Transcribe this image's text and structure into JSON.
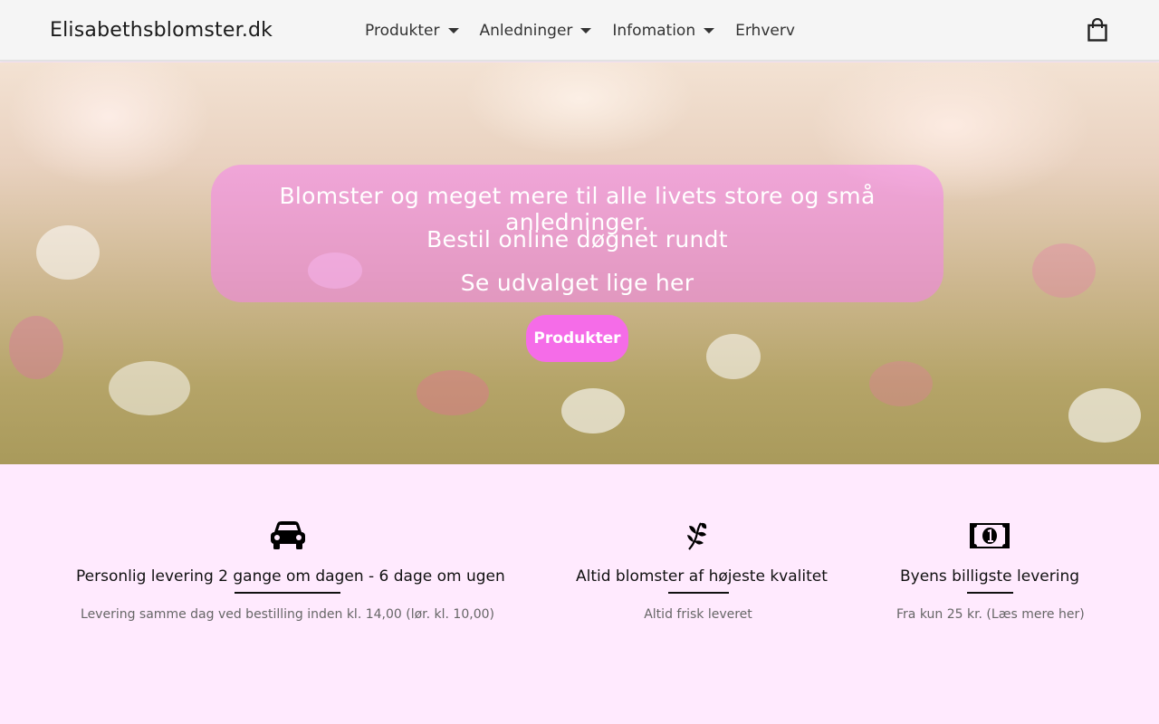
{
  "header": {
    "logo": "Elisabethsblomster.dk",
    "nav": [
      {
        "label": "Produkter",
        "dropdown": true
      },
      {
        "label": "Anledninger",
        "dropdown": true
      },
      {
        "label": "Infomation",
        "dropdown": true
      },
      {
        "label": "Erhverv",
        "dropdown": false
      }
    ],
    "cart_icon": "shopping-bag-icon"
  },
  "hero": {
    "line1": "Blomster og meget mere til alle livets store og små anledninger.",
    "line2": "Bestil online døgnet rundt",
    "line3": "Se udvalget lige her",
    "button_label": "Produkter"
  },
  "features": [
    {
      "icon": "car-icon",
      "title": "Personlig levering 2 gange om dagen - 6 dage om ugen",
      "desc": "Levering samme dag ved bestilling inden kl. 14,00 (lør. kl. 10,00)"
    },
    {
      "icon": "leaf-icon",
      "title": "Altid blomster af højeste kvalitet",
      "desc": "Altid frisk leveret"
    },
    {
      "icon": "money-icon",
      "title": "Byens billigste levering",
      "desc": "Fra kun 25 kr. (Læs mere her)"
    }
  ],
  "colors": {
    "accent": "#f56ce8",
    "panel": "#f682ec",
    "page_bg": "#ffeafe",
    "header_bg": "#f5f5f5"
  }
}
